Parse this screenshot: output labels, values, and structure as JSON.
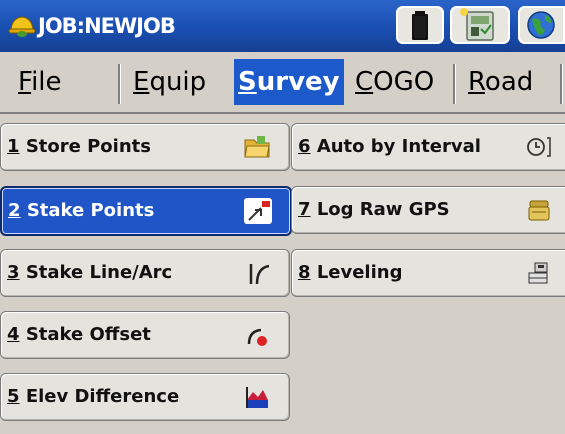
{
  "window": {
    "title": "JOB:NEWJOB"
  },
  "icons": {
    "app": "hard-hat-icon",
    "battery": "battery-icon",
    "config": "settings-icon",
    "globe": "globe-icon"
  },
  "menu": [
    {
      "key": "F",
      "rest": "ile"
    },
    {
      "key": "E",
      "rest": "quip"
    },
    {
      "key": "S",
      "rest": "urvey",
      "selected": true
    },
    {
      "key": "C",
      "rest": "OGO"
    },
    {
      "key": "R",
      "rest": "oad"
    }
  ],
  "items": [
    {
      "num": "1",
      "label": "Store Points",
      "icon": "folder-icon"
    },
    {
      "num": "2",
      "label": "Stake Points",
      "icon": "stake-flag-icon",
      "selected": true
    },
    {
      "num": "3",
      "label": "Stake Line/Arc",
      "icon": "line-arc-icon"
    },
    {
      "num": "4",
      "label": "Stake Offset",
      "icon": "offset-icon"
    },
    {
      "num": "5",
      "label": "Elev Difference",
      "icon": "elevation-icon"
    },
    {
      "num": "6",
      "label": "Auto by Interval",
      "icon": "clock-icon"
    },
    {
      "num": "7",
      "label": "Log Raw GPS",
      "icon": "log-icon"
    },
    {
      "num": "8",
      "label": "Leveling",
      "icon": "leveling-icon"
    }
  ],
  "colors": {
    "titlebar": "#1a4fb1",
    "selection": "#1f55c7",
    "background": "#d4d0c8"
  }
}
